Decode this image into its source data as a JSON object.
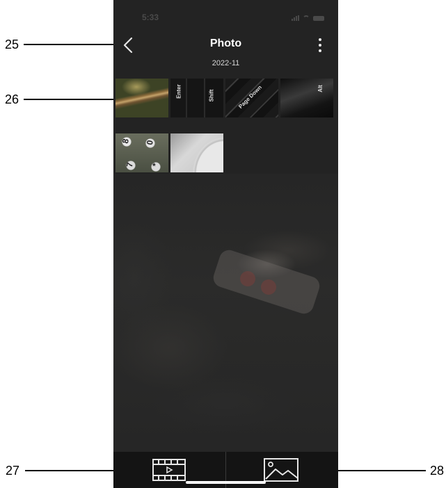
{
  "callouts": {
    "c25": "25",
    "c26": "26",
    "c27": "27",
    "c28": "28"
  },
  "status_bar": {
    "time": "5:33"
  },
  "nav": {
    "title": "Photo",
    "back_icon": "chevron-left-icon",
    "more_icon": "more-vertical-icon"
  },
  "gallery": {
    "date_group": "2022-11",
    "thumbnails": [
      {
        "subject": "close-up green/brown photo"
      },
      {
        "subject": "keyboard keys",
        "keys": [
          "Enter",
          "Shift"
        ]
      },
      {
        "subject": "keyboard keys",
        "keys": [
          "Page Down"
        ]
      },
      {
        "subject": "keyboard key",
        "keys": [
          "Alt"
        ]
      },
      {
        "subject": "keypad buttons",
        "keys": [
          "8",
          "0",
          "7",
          "*"
        ]
      },
      {
        "subject": "white glass surface"
      }
    ]
  },
  "tab_bar": {
    "video_icon": "film-video-icon",
    "photo_icon": "image-photo-icon"
  }
}
